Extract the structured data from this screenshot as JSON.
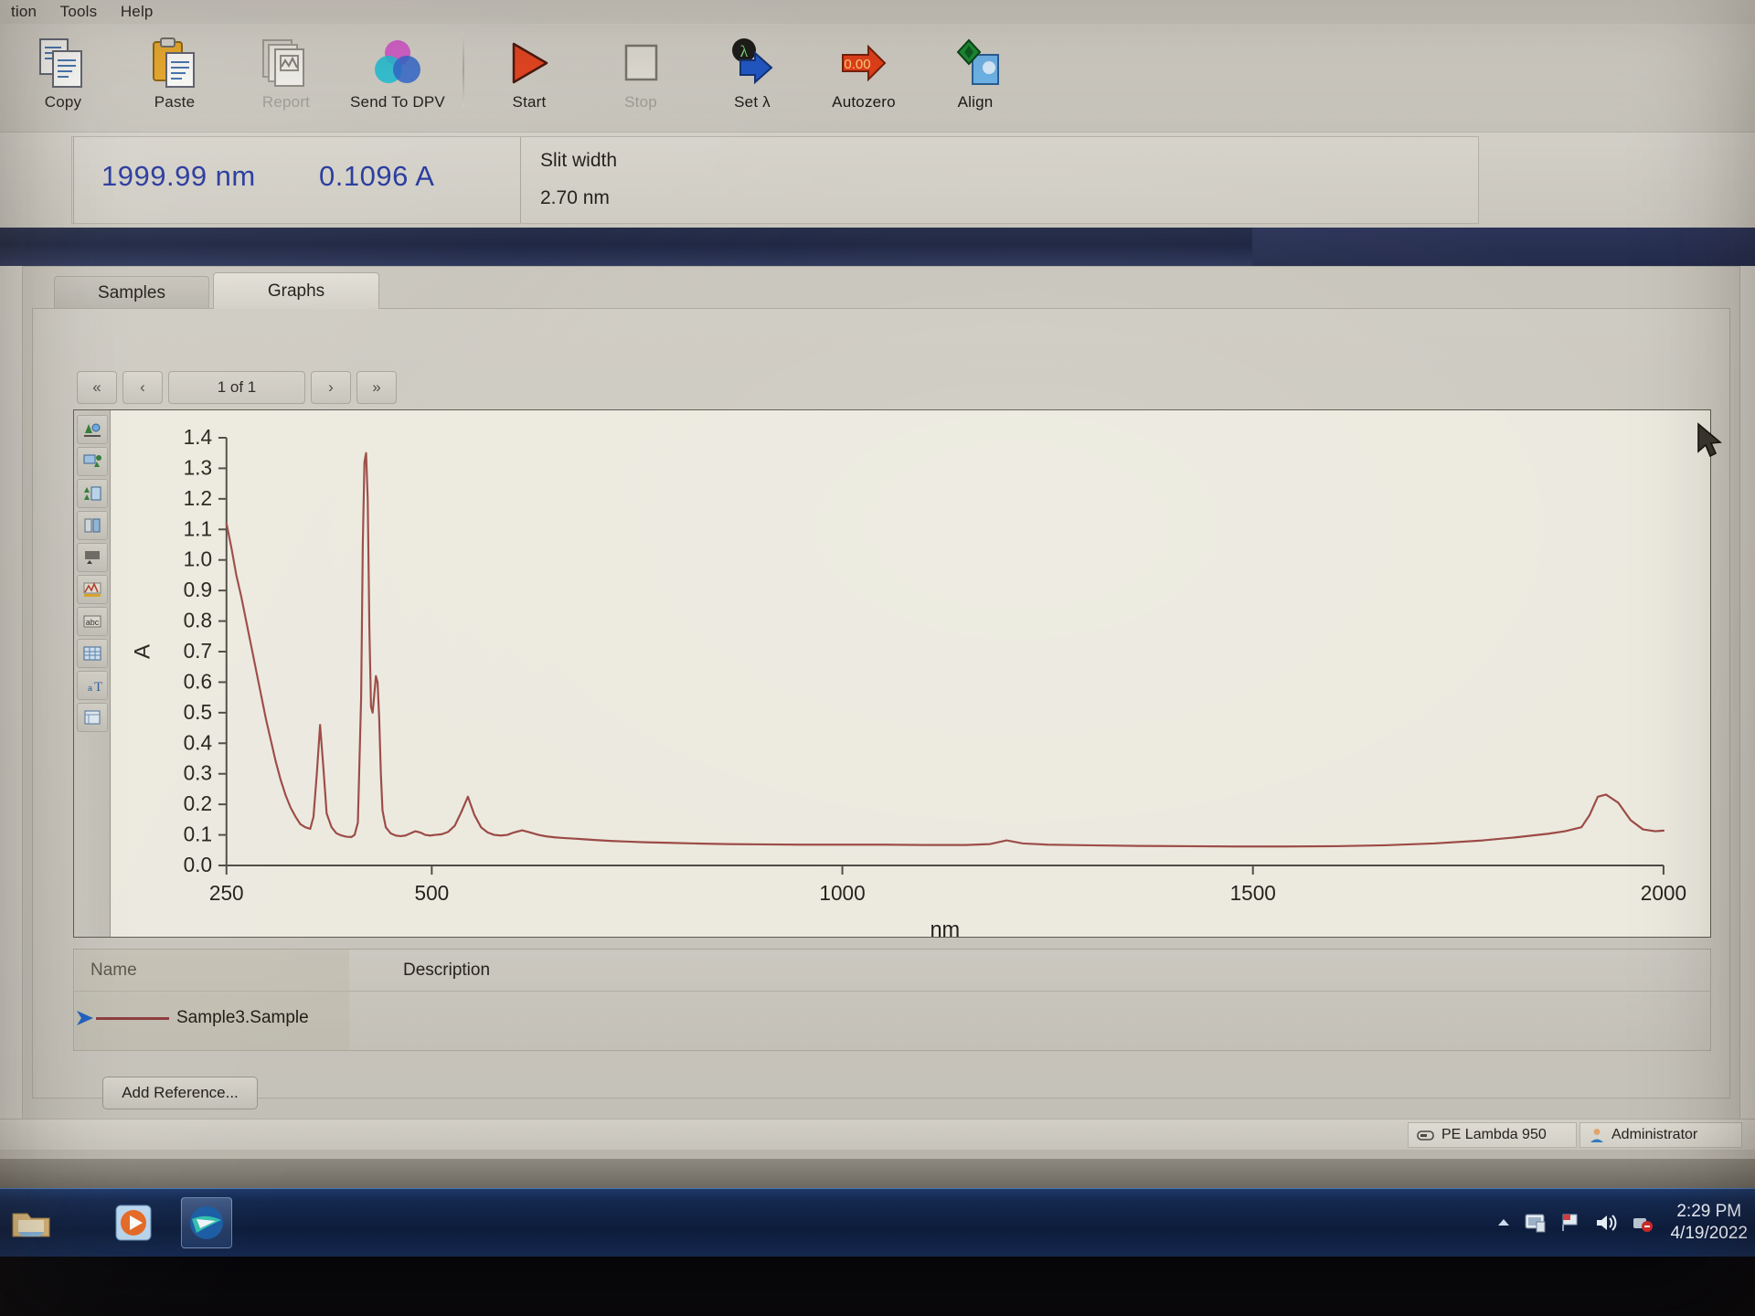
{
  "window": {
    "menu": [
      "tion",
      "Tools",
      "Help"
    ]
  },
  "toolbar": {
    "buttons": [
      {
        "label": "Copy",
        "icon": "copy-icon",
        "enabled": true
      },
      {
        "label": "Paste",
        "icon": "paste-icon",
        "enabled": true
      },
      {
        "label": "Report",
        "icon": "report-icon",
        "enabled": false
      },
      {
        "label": "Send To DPV",
        "icon": "send-to-dpv-icon",
        "enabled": true
      },
      {
        "label": "Start",
        "icon": "play-icon",
        "enabled": true
      },
      {
        "label": "Stop",
        "icon": "stop-icon",
        "enabled": false
      },
      {
        "label": "Set λ",
        "icon": "set-lambda-icon",
        "enabled": true
      },
      {
        "label": "Autozero",
        "icon": "autozero-icon",
        "enabled": true
      },
      {
        "label": "Align",
        "icon": "align-icon",
        "enabled": true
      }
    ]
  },
  "readout": {
    "wavelength": "1999.99 nm",
    "absorbance": "0.1096 A",
    "slit_width_label": "Slit width",
    "slit_width_value": "2.70 nm"
  },
  "tabs": [
    {
      "label": "Samples",
      "active": false
    },
    {
      "label": "Graphs",
      "active": true
    }
  ],
  "pager": {
    "first": "«",
    "prev": "‹",
    "page": "1 of 1",
    "next": "›",
    "last": "»"
  },
  "graph_tools": [
    "zoom-all-icon",
    "zoom-region-icon",
    "zoom-out-icon",
    "cursor-icon",
    "scale-icon",
    "peaks-icon",
    "abc-label-icon",
    "grid-icon",
    "text-tool-icon",
    "properties-icon"
  ],
  "legend": {
    "columns": [
      "Name",
      "Description"
    ],
    "rows": [
      {
        "name": "Sample3.Sample",
        "description": "",
        "color": "#8d3a3c"
      }
    ]
  },
  "buttons": {
    "add_reference": "Add Reference..."
  },
  "statusbar": {
    "instrument": "PE Lambda 950",
    "user": "Administrator"
  },
  "taskbar": {
    "items": [
      "explorer-icon",
      "media-player-icon",
      "uv-winlab-icon"
    ],
    "tray_icons": [
      "show-hidden-icon",
      "network-icon",
      "action-center-flag-icon",
      "volume-icon",
      "safely-remove-icon"
    ],
    "time": "2:29 PM",
    "date": "4/19/2022"
  },
  "chart_data": {
    "type": "line",
    "title": "",
    "xlabel": "nm",
    "ylabel": "A",
    "xlim": [
      250,
      2000
    ],
    "ylim": [
      0.0,
      1.4
    ],
    "xticks": [
      250,
      500,
      1000,
      1500,
      2000
    ],
    "yticks": [
      0.0,
      0.1,
      0.2,
      0.3,
      0.4,
      0.5,
      0.6,
      0.7,
      0.8,
      0.9,
      1.0,
      1.1,
      1.2,
      1.3,
      1.4
    ],
    "grid": false,
    "legend_position": "below-plot",
    "series": [
      {
        "name": "Sample3.Sample",
        "color": "#9c4a46",
        "x": [
          250,
          256,
          262,
          268,
          274,
          280,
          286,
          292,
          298,
          304,
          310,
          316,
          322,
          328,
          334,
          340,
          346,
          352,
          356,
          360,
          364,
          368,
          372,
          378,
          384,
          390,
          396,
          402,
          406,
          410,
          414,
          416,
          418,
          420,
          422,
          424,
          426,
          428,
          430,
          432,
          434,
          436,
          438,
          440,
          444,
          450,
          456,
          462,
          468,
          474,
          480,
          486,
          492,
          498,
          504,
          512,
          520,
          528,
          536,
          544,
          552,
          560,
          568,
          576,
          584,
          592,
          600,
          610,
          620,
          630,
          640,
          650,
          660,
          672,
          684,
          700,
          720,
          740,
          760,
          790,
          820,
          860,
          900,
          950,
          1000,
          1050,
          1100,
          1150,
          1180,
          1200,
          1220,
          1250,
          1300,
          1360,
          1420,
          1480,
          1540,
          1600,
          1660,
          1720,
          1780,
          1820,
          1860,
          1880,
          1900,
          1910,
          1920,
          1930,
          1945,
          1960,
          1975,
          1990,
          2000
        ],
        "y": [
          1.12,
          1.04,
          0.95,
          0.88,
          0.8,
          0.72,
          0.64,
          0.56,
          0.48,
          0.41,
          0.34,
          0.28,
          0.23,
          0.19,
          0.16,
          0.135,
          0.125,
          0.12,
          0.16,
          0.3,
          0.46,
          0.32,
          0.17,
          0.125,
          0.105,
          0.098,
          0.094,
          0.093,
          0.1,
          0.14,
          0.55,
          1.05,
          1.32,
          1.35,
          1.2,
          0.78,
          0.52,
          0.5,
          0.56,
          0.62,
          0.6,
          0.48,
          0.3,
          0.18,
          0.125,
          0.105,
          0.098,
          0.096,
          0.098,
          0.105,
          0.112,
          0.108,
          0.1,
          0.098,
          0.1,
          0.102,
          0.11,
          0.13,
          0.175,
          0.225,
          0.165,
          0.125,
          0.108,
          0.1,
          0.098,
          0.1,
          0.108,
          0.115,
          0.108,
          0.1,
          0.095,
          0.092,
          0.09,
          0.088,
          0.086,
          0.083,
          0.08,
          0.078,
          0.076,
          0.074,
          0.072,
          0.07,
          0.069,
          0.068,
          0.068,
          0.068,
          0.067,
          0.067,
          0.07,
          0.082,
          0.072,
          0.068,
          0.066,
          0.064,
          0.063,
          0.062,
          0.062,
          0.063,
          0.066,
          0.072,
          0.082,
          0.092,
          0.104,
          0.112,
          0.125,
          0.165,
          0.225,
          0.232,
          0.205,
          0.148,
          0.118,
          0.112,
          0.114,
          0.118
        ]
      }
    ]
  }
}
